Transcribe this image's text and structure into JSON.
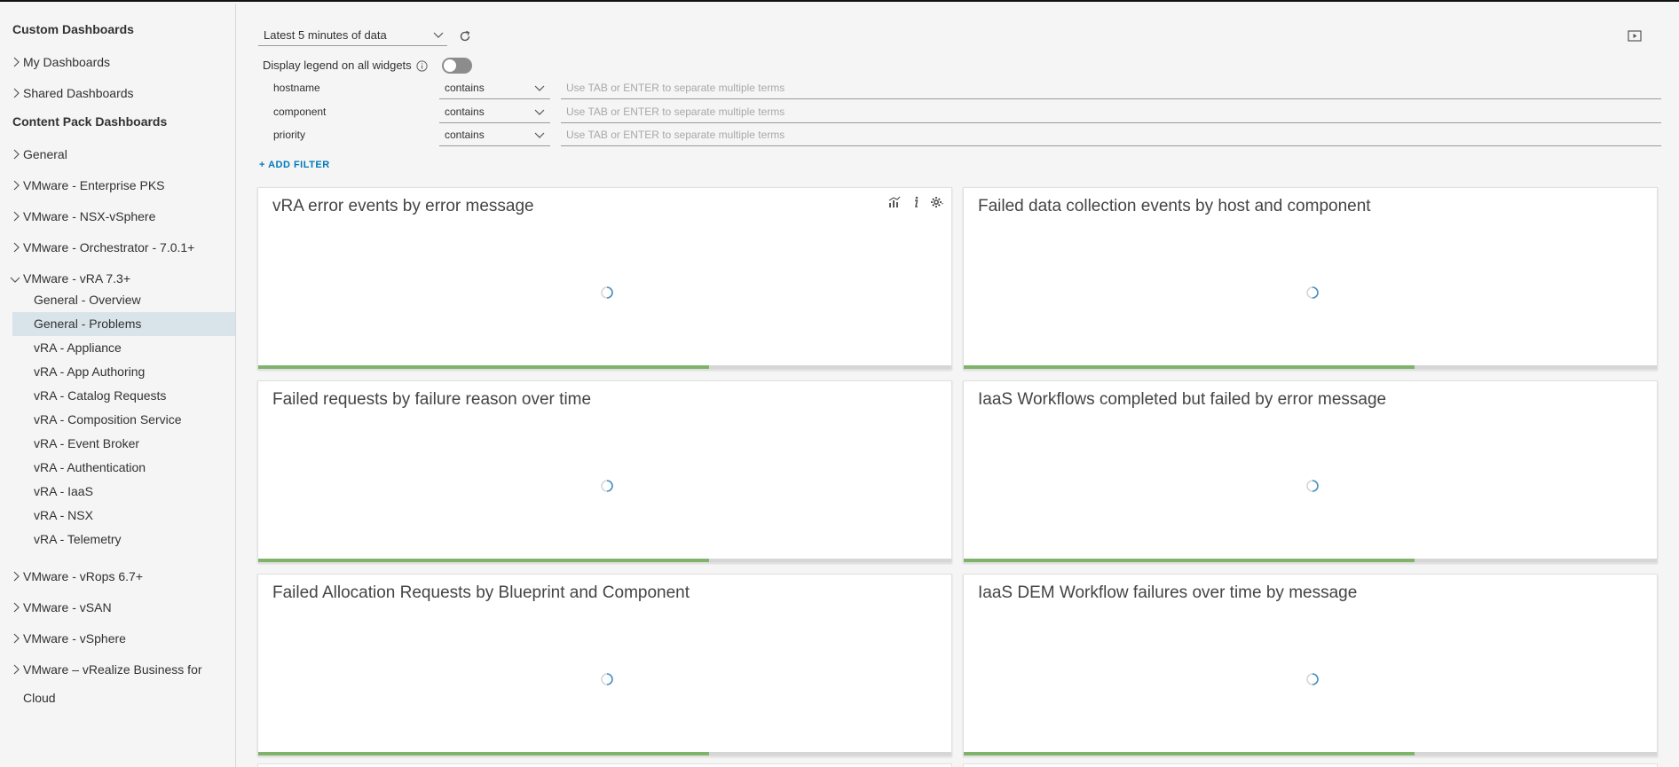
{
  "sidebar": {
    "custom_title": "Custom Dashboards",
    "custom_groups": [
      {
        "label": "My Dashboards"
      },
      {
        "label": "Shared Dashboards"
      }
    ],
    "content_title": "Content Pack Dashboards",
    "content_groups_top": [
      {
        "label": "General"
      },
      {
        "label": "VMware - Enterprise PKS"
      },
      {
        "label": "VMware - NSX-vSphere"
      },
      {
        "label": "VMware - Orchestrator - 7.0.1+"
      }
    ],
    "open_group": {
      "label": "VMware - vRA 7.3+",
      "items": [
        {
          "label": "General - Overview",
          "active": false
        },
        {
          "label": "General - Problems",
          "active": true
        },
        {
          "label": "vRA - Appliance",
          "active": false
        },
        {
          "label": "vRA - App Authoring",
          "active": false
        },
        {
          "label": "vRA - Catalog Requests",
          "active": false
        },
        {
          "label": "vRA - Composition Service",
          "active": false
        },
        {
          "label": "vRA - Event Broker",
          "active": false
        },
        {
          "label": "vRA - Authentication",
          "active": false
        },
        {
          "label": "vRA - IaaS",
          "active": false
        },
        {
          "label": "vRA - NSX",
          "active": false
        },
        {
          "label": "vRA - Telemetry",
          "active": false
        }
      ]
    },
    "content_groups_bottom": [
      {
        "label": "VMware - vRops 6.7+"
      },
      {
        "label": "VMware - vSAN"
      },
      {
        "label": "VMware - vSphere"
      },
      {
        "label": "VMware – vRealize Business for Cloud"
      }
    ]
  },
  "toolbar": {
    "time_range": "Latest 5 minutes of data",
    "legend_label": "Display legend on all widgets",
    "legend_on": false
  },
  "filters": [
    {
      "field": "hostname",
      "operator": "contains",
      "placeholder": "Use TAB or ENTER to separate multiple terms"
    },
    {
      "field": "component",
      "operator": "contains",
      "placeholder": "Use TAB or ENTER to separate multiple terms"
    },
    {
      "field": "priority",
      "operator": "contains",
      "placeholder": "Use TAB or ENTER to separate multiple terms"
    }
  ],
  "add_filter_label": "+ ADD FILTER",
  "widgets": [
    {
      "title": "vRA error events by error message",
      "progress": 0.65,
      "has_tools": true
    },
    {
      "title": "Failed data collection events by host and component",
      "progress": 0.65,
      "has_tools": false
    },
    {
      "title": "Failed requests by failure reason over time",
      "progress": 0.65,
      "has_tools": false
    },
    {
      "title": "IaaS Workflows completed but failed by error message",
      "progress": 0.65,
      "has_tools": false
    },
    {
      "title": "Failed Allocation Requests by Blueprint and Component",
      "progress": 0.65,
      "has_tools": false
    },
    {
      "title": "IaaS DEM Workflow failures over time by message",
      "progress": 0.65,
      "has_tools": false
    }
  ],
  "colors": {
    "accent": "#0079b8",
    "progress": "#7fb36a",
    "active_item": "#d9e4ea",
    "spinner": "#4a90c2"
  },
  "icons": [
    "chevron-right-icon",
    "chevron-down-icon",
    "refresh-icon",
    "info-icon",
    "presentation-icon",
    "chart-icon",
    "info-letter-icon",
    "gear-icon",
    "spinner-icon"
  ]
}
